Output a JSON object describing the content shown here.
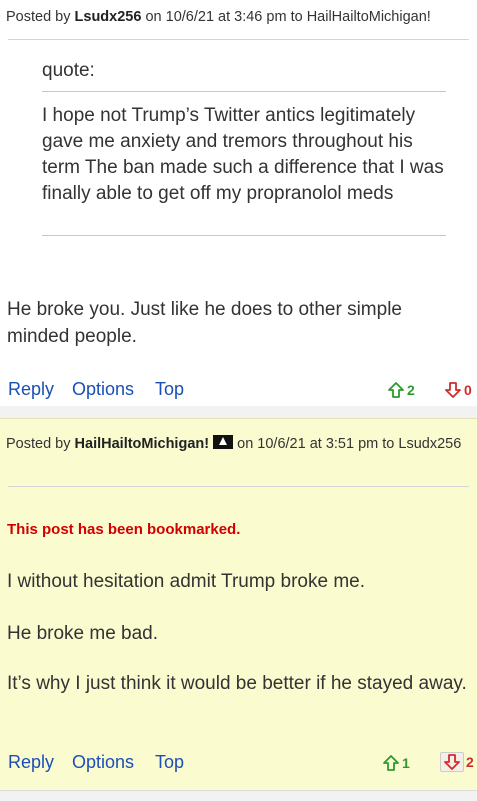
{
  "post1": {
    "header": {
      "prefix": "Posted by",
      "author": "Lsudx256",
      "on": "on 10/6/21 at 3:46 pm to",
      "recipient": "HailHailtoMichigan!"
    },
    "quote": {
      "label": "quote:",
      "text": "I hope not Trump’s Twitter antics legitimately gave me anxiety and tremors throughout his term The ban made such a difference that I was finally able to get off my propranolol meds"
    },
    "body": "He broke you. Just like he does to other simple minded people.",
    "actions": {
      "reply": "Reply",
      "options": "Options",
      "top": "Top"
    },
    "votes": {
      "up": "2",
      "down": "0"
    }
  },
  "post2": {
    "header": {
      "prefix": "Posted by",
      "author": "HailHailtoMichigan!",
      "on": "on 10/6/21 at 3:51 pm to",
      "recipient": "Lsudx256"
    },
    "bookmark_note": "This post has been bookmarked.",
    "paragraphs": [
      "I without hesitation admit Trump broke me.",
      "He broke me bad.",
      "It’s why I just think it would be better if he stayed away."
    ],
    "actions": {
      "reply": "Reply",
      "options": "Options",
      "top": "Top"
    },
    "votes": {
      "up": "1",
      "down": "2"
    }
  },
  "colors": {
    "link": "#1a4fb6",
    "upvote": "#2e9a2e",
    "downvote": "#d32b2b",
    "bookmark_note": "#d20000",
    "highlight_bg": "#fbfbd0"
  },
  "icons": [
    "up-arrow-icon",
    "down-arrow-icon",
    "user-badge-icon"
  ]
}
